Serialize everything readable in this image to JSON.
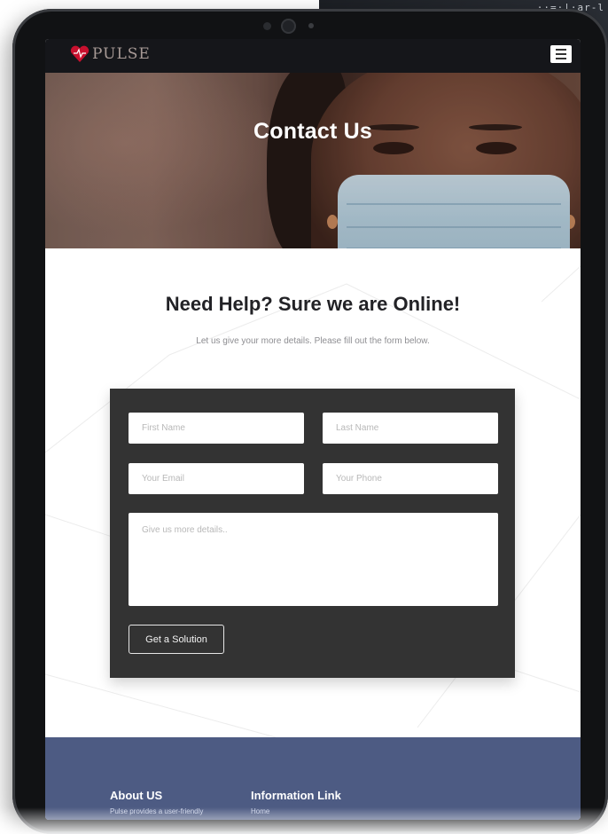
{
  "backdrop": {
    "text": "··=·|·ar-l"
  },
  "navbar": {
    "brand_name": "PULSE",
    "menu_icon": "hamburger-menu-icon"
  },
  "hero": {
    "title": "Contact Us"
  },
  "section": {
    "heading": "Need Help? Sure we are Online!",
    "subtext": "Let us give your more details. Please fill out the form below."
  },
  "form": {
    "first_name_placeholder": "First Name",
    "last_name_placeholder": "Last Name",
    "email_placeholder": "Your Email",
    "phone_placeholder": "Your Phone",
    "message_placeholder": "Give us more details..",
    "submit_label": "Get a Solution"
  },
  "footer": {
    "about_title": "About US",
    "about_text": "Pulse provides a user-friendly",
    "links_title": "Information Link",
    "links_first": "Home"
  },
  "colors": {
    "nav_bg": "#15161a",
    "brand_red": "#c8102e",
    "form_bg": "#333333",
    "footer_bg": "#4d5b83",
    "heading_text": "#222226"
  }
}
